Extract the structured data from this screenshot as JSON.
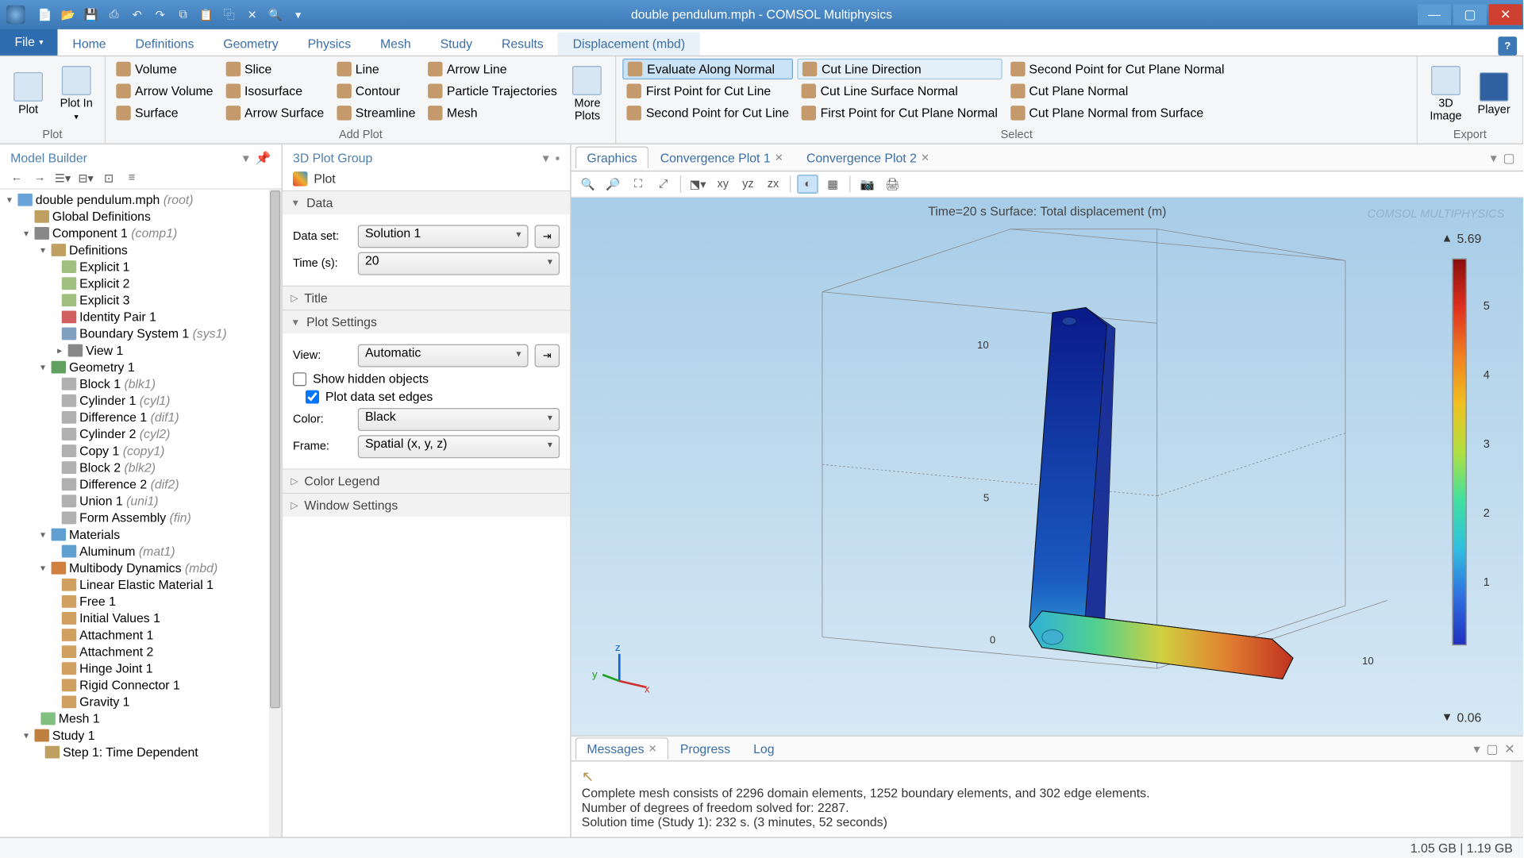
{
  "window": {
    "title": "double pendulum.mph - COMSOL Multiphysics"
  },
  "ribbon": {
    "file": "File",
    "tabs": [
      "Home",
      "Definitions",
      "Geometry",
      "Physics",
      "Mesh",
      "Study",
      "Results"
    ],
    "contextual_tab": "Displacement (mbd)",
    "groups": {
      "plot": {
        "label": "Plot",
        "plot": "Plot",
        "plot_in": "Plot In"
      },
      "add_plot": {
        "label": "Add Plot",
        "col1": [
          "Volume",
          "Arrow Volume",
          "Surface"
        ],
        "col2": [
          "Slice",
          "Isosurface",
          "Arrow Surface"
        ],
        "col3": [
          "Line",
          "Contour",
          "Streamline"
        ],
        "col4": [
          "Arrow Line",
          "Particle Trajectories",
          "Mesh"
        ],
        "more": "More Plots"
      },
      "select": {
        "label": "Select",
        "col1": [
          "Evaluate Along Normal",
          "First Point for Cut Line",
          "Second Point for Cut Line"
        ],
        "col2": [
          "Cut Line Direction",
          "Cut Line Surface Normal",
          "First Point for Cut Plane Normal"
        ],
        "col3": [
          "Second Point for Cut Plane Normal",
          "Cut Plane Normal",
          "Cut Plane Normal from Surface"
        ]
      },
      "export": {
        "label": "Export",
        "image3d": "3D Image",
        "player": "Player"
      }
    }
  },
  "model_builder": {
    "title": "Model Builder",
    "root": "double pendulum.mph",
    "root_tag": "(root)",
    "nodes": {
      "global_defs": "Global Definitions",
      "component": "Component 1",
      "component_tag": "(comp1)",
      "definitions": "Definitions",
      "explicit1": "Explicit 1",
      "explicit2": "Explicit 2",
      "explicit3": "Explicit 3",
      "identity_pair": "Identity Pair 1",
      "boundary_system": "Boundary System 1",
      "boundary_system_tag": "(sys1)",
      "view1": "View 1",
      "geometry": "Geometry 1",
      "block1": "Block 1",
      "block1_tag": "(blk1)",
      "cyl1": "Cylinder 1",
      "cyl1_tag": "(cyl1)",
      "diff1": "Difference 1",
      "diff1_tag": "(dif1)",
      "cyl2": "Cylinder 2",
      "cyl2_tag": "(cyl2)",
      "copy1": "Copy 1",
      "copy1_tag": "(copy1)",
      "block2": "Block 2",
      "block2_tag": "(blk2)",
      "diff2": "Difference 2",
      "diff2_tag": "(dif2)",
      "union1": "Union 1",
      "union1_tag": "(uni1)",
      "formasm": "Form Assembly",
      "formasm_tag": "(fin)",
      "materials": "Materials",
      "aluminum": "Aluminum",
      "aluminum_tag": "(mat1)",
      "mbd": "Multibody Dynamics",
      "mbd_tag": "(mbd)",
      "lem": "Linear Elastic Material 1",
      "free1": "Free 1",
      "initial": "Initial Values 1",
      "att1": "Attachment 1",
      "att2": "Attachment 2",
      "hinge": "Hinge Joint 1",
      "rigid": "Rigid Connector 1",
      "gravity": "Gravity 1",
      "mesh1": "Mesh 1",
      "study1": "Study 1",
      "step1": "Step 1: Time Dependent"
    }
  },
  "settings": {
    "title": "3D Plot Group",
    "plot_btn": "Plot",
    "sections": {
      "data": "Data",
      "title": "Title",
      "plot_settings": "Plot Settings",
      "color_legend": "Color Legend",
      "window_settings": "Window Settings"
    },
    "data": {
      "dataset_label": "Data set:",
      "dataset_value": "Solution 1",
      "time_label": "Time (s):",
      "time_value": "20"
    },
    "plot_settings": {
      "view_label": "View:",
      "view_value": "Automatic",
      "show_hidden": "Show hidden objects",
      "plot_edges": "Plot data set edges",
      "color_label": "Color:",
      "color_value": "Black",
      "frame_label": "Frame:",
      "frame_value": "Spatial  (x, y, z)"
    }
  },
  "graphics": {
    "tabs": {
      "graphics": "Graphics",
      "conv1": "Convergence Plot 1",
      "conv2": "Convergence Plot 2"
    },
    "plot_title": "Time=20 s   Surface: Total displacement (m)",
    "watermark": "COMSOL MULTIPHYSICS",
    "max": "5.69",
    "min": "0.06",
    "ticks": [
      "5",
      "4",
      "3",
      "2",
      "1"
    ],
    "axis_labels": {
      "x": "x",
      "y": "y",
      "z": "z"
    },
    "grid_labels": {
      "z10": "10",
      "z5": "5",
      "z0": "0",
      "x10": "10"
    }
  },
  "messages": {
    "tabs": {
      "messages": "Messages",
      "progress": "Progress",
      "log": "Log"
    },
    "line1": "Complete mesh consists of 2296 domain elements, 1252 boundary elements, and 302 edge elements.",
    "line2": "Number of degrees of freedom solved for: 2287.",
    "line3": "Solution time (Study 1): 232 s. (3 minutes, 52 seconds)"
  },
  "status": {
    "memory": "1.05 GB | 1.19 GB"
  }
}
